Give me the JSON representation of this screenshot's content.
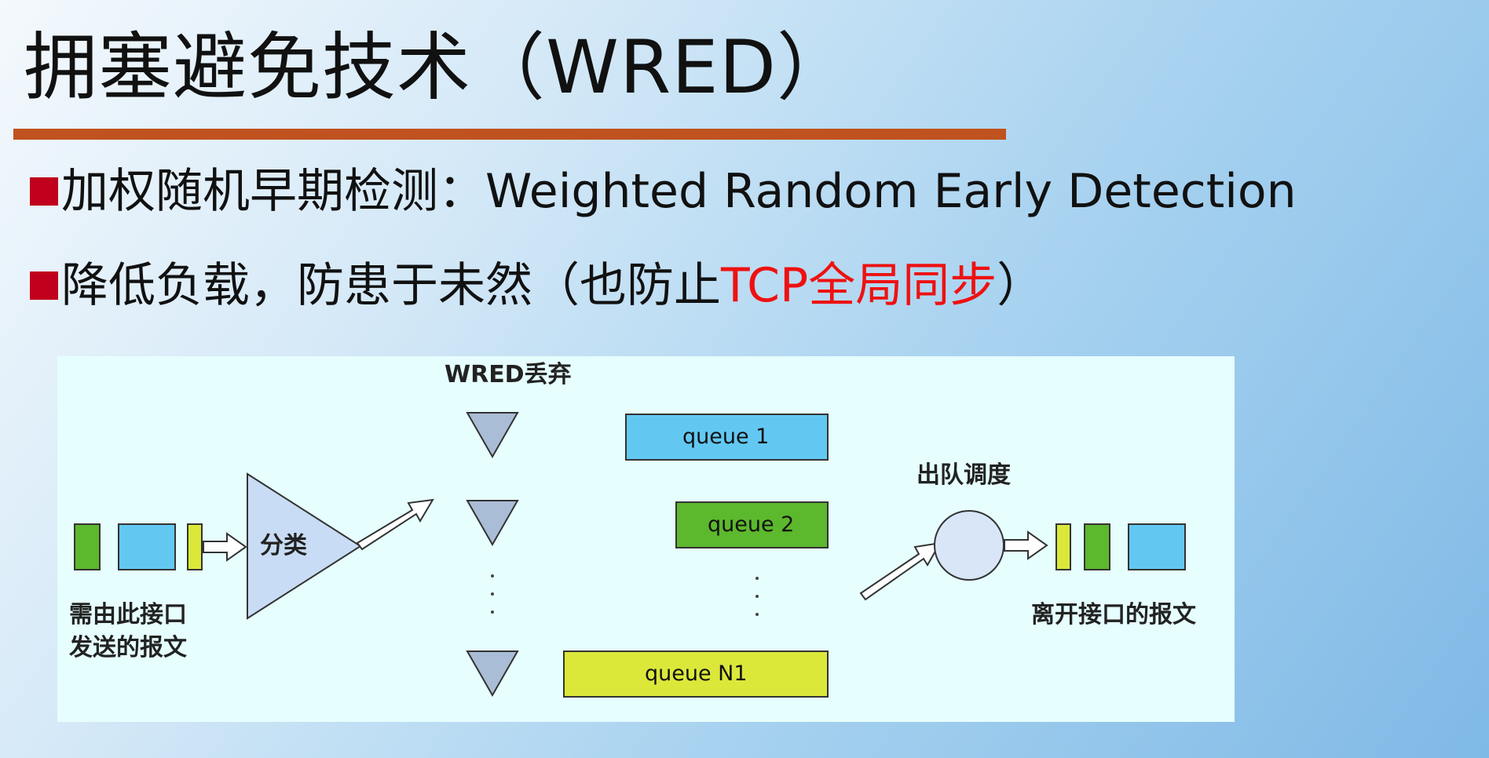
{
  "title": "拥塞避免技术（WRED）",
  "bullets": [
    {
      "text": "加权随机早期检测：Weighted Random Early Detection"
    },
    {
      "text_before": "降低负载，防患于未然（也防止",
      "highlight": "TCP全局同步",
      "text_after": "）"
    }
  ],
  "colors": {
    "title_rule": "#c0521f",
    "bullet_marker": "#c0001c",
    "highlight": "#ee1111",
    "diagram_bg": "#e6fefe",
    "packet_green": "#5cb82d",
    "packet_blue": "#62c8f2",
    "packet_yellow": "#dbe83a",
    "shape_fill": "#c8dcf5"
  },
  "diagram": {
    "wred_label": "WRED丢弃",
    "classify_label": "分类",
    "scheduler_label": "出队调度",
    "input_label_line1": "需由此接口",
    "input_label_line2": "发送的报文",
    "output_label": "离开接口的报文",
    "queues": [
      {
        "label": "queue  1",
        "color": "blue"
      },
      {
        "label": "queue  2",
        "color": "green"
      },
      {
        "label": "queue  N1",
        "color": "yellow"
      }
    ]
  }
}
